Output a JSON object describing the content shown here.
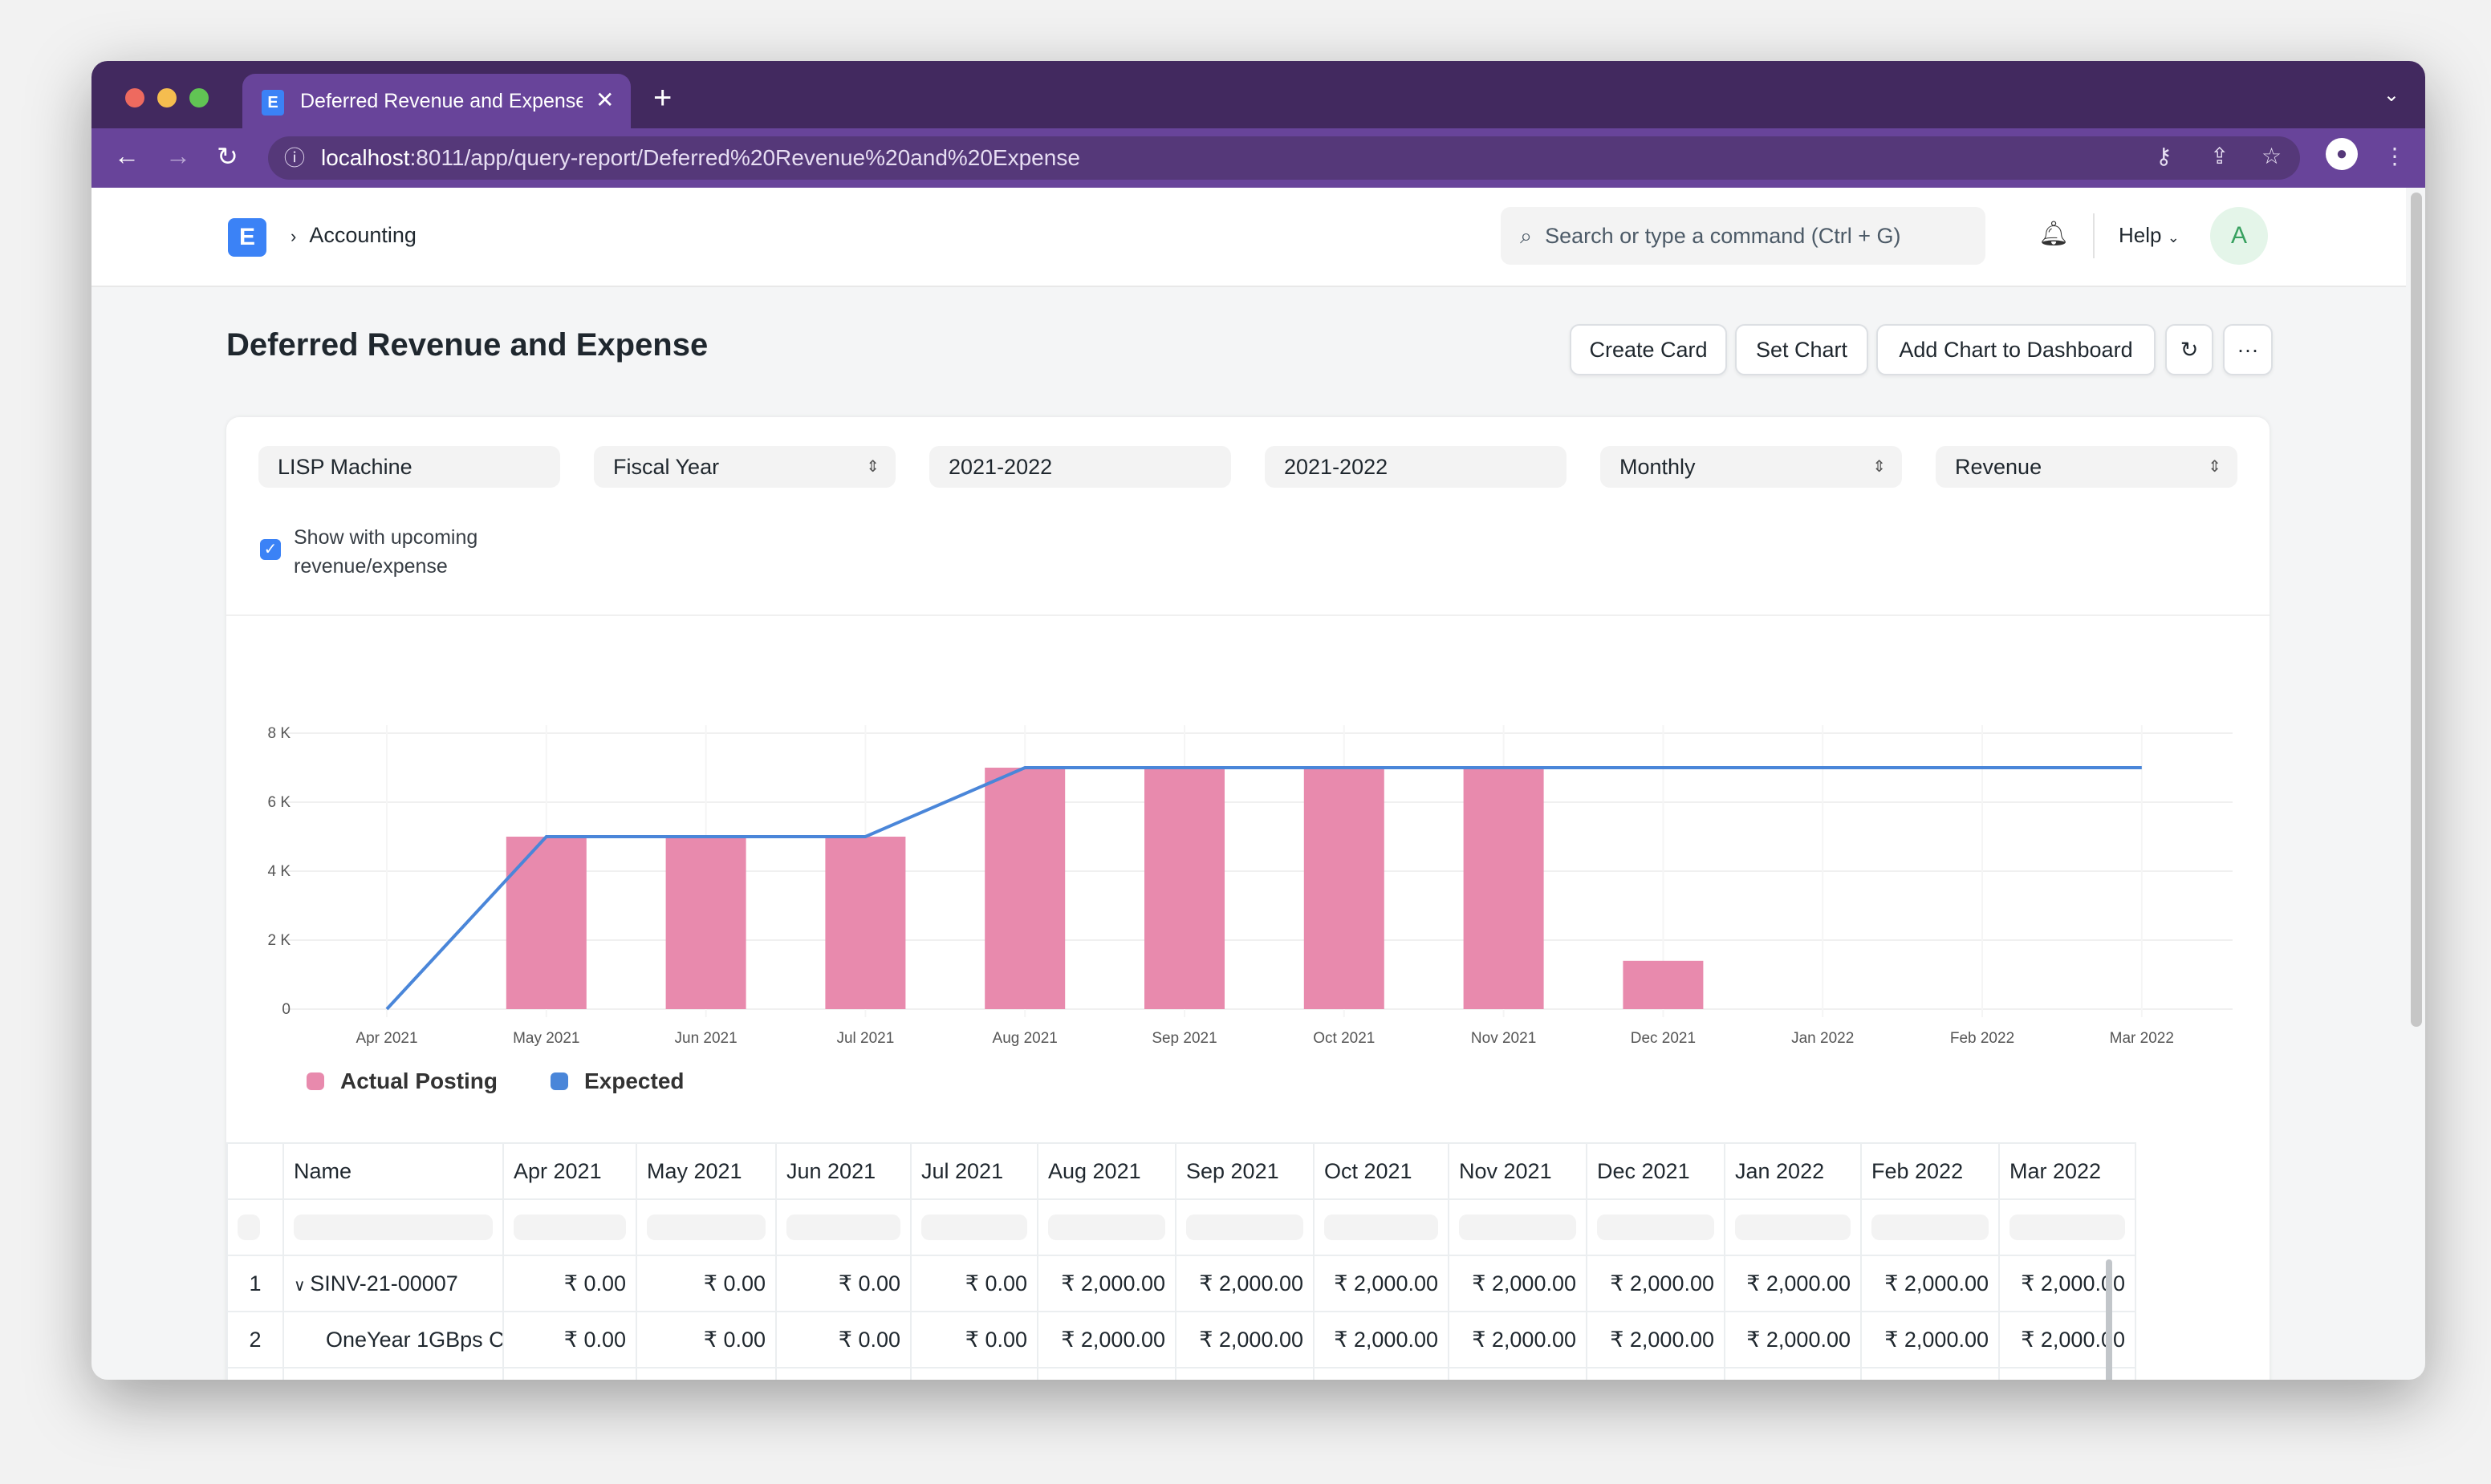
{
  "browser": {
    "tab_title": "Deferred Revenue and Expense",
    "url_host": "localhost",
    "url_path": ":8011/app/query-report/Deferred%20Revenue%20and%20Expense"
  },
  "navbar": {
    "breadcrumb": "Accounting",
    "search_placeholder": "Search or type a command (Ctrl + G)",
    "help": "Help",
    "avatar": "A"
  },
  "page": {
    "title": "Deferred Revenue and Expense",
    "buttons": [
      "Create Card",
      "Set Chart",
      "Add Chart to Dashboard"
    ]
  },
  "filters": {
    "company": "LISP Machine",
    "filter_based_on": "Fiscal Year",
    "from_fiscal_year": "2021-2022",
    "to_fiscal_year": "2021-2022",
    "periodicity": "Monthly",
    "type": "Revenue",
    "show_upcoming_label": "Show with upcoming revenue/expense",
    "show_upcoming_checked": true
  },
  "chart_data": {
    "type": "bar+line",
    "categories": [
      "Apr 2021",
      "May 2021",
      "Jun 2021",
      "Jul 2021",
      "Aug 2021",
      "Sep 2021",
      "Oct 2021",
      "Nov 2021",
      "Dec 2021",
      "Jan 2022",
      "Feb 2022",
      "Mar 2022"
    ],
    "y_ticks": [
      "0",
      "2 K",
      "4 K",
      "6 K",
      "8 K"
    ],
    "ylim": [
      0,
      8000
    ],
    "grid": true,
    "legend": "bottom-left",
    "series": [
      {
        "name": "Actual Posting",
        "type": "bar",
        "color": "#e88aad",
        "values": [
          0,
          5000,
          5000,
          5000,
          7000,
          7000,
          7000,
          7000,
          1400,
          0,
          0,
          0
        ]
      },
      {
        "name": "Expected",
        "type": "line",
        "color": "#4a86d9",
        "values": [
          0,
          5000,
          5000,
          5000,
          7000,
          7000,
          7000,
          7000,
          7000,
          7000,
          7000,
          7000
        ]
      }
    ]
  },
  "table": {
    "columns": [
      "Name",
      "Apr 2021",
      "May 2021",
      "Jun 2021",
      "Jul 2021",
      "Aug 2021",
      "Sep 2021",
      "Oct 2021",
      "Nov 2021",
      "Dec 2021",
      "Jan 2022",
      "Feb 2022",
      "Mar 2022"
    ],
    "rows": [
      {
        "idx": "1",
        "name": "SINV-21-00007",
        "values": [
          "₹ 0.00",
          "₹ 0.00",
          "₹ 0.00",
          "₹ 0.00",
          "₹ 2,000.00",
          "₹ 2,000.00",
          "₹ 2,000.00",
          "₹ 2,000.00",
          "₹ 2,000.00",
          "₹ 2,000.00",
          "₹ 2,000.00",
          "₹ 2,000.00"
        ]
      },
      {
        "idx": "2",
        "name": "OneYear 1GBps C",
        "values": [
          "₹ 0.00",
          "₹ 0.00",
          "₹ 0.00",
          "₹ 0.00",
          "₹ 2,000.00",
          "₹ 2,000.00",
          "₹ 2,000.00",
          "₹ 2,000.00",
          "₹ 2,000.00",
          "₹ 2,000.00",
          "₹ 2,000.00",
          "₹ 2,000.00"
        ]
      }
    ]
  }
}
